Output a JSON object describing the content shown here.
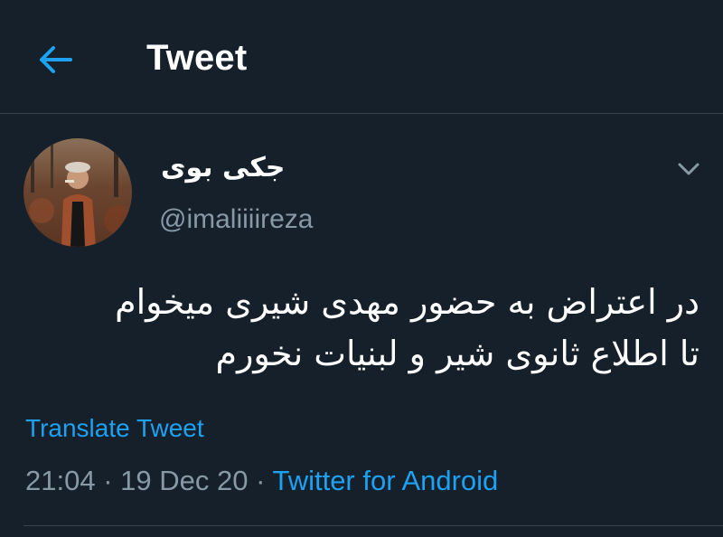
{
  "header": {
    "back_icon": "arrow-left-icon",
    "title": "Tweet"
  },
  "author": {
    "display_name": "جکی بوی",
    "handle": "@imaliiiireza",
    "avatar_icon": "avatar-photo",
    "more_icon": "chevron-down-icon"
  },
  "tweet": {
    "lines": [
      "در اعتراض به حضور مهدی شیری میخوام",
      "تا اطلاع ثانوی شیر و لبنیات نخورم"
    ],
    "translate_label": "Translate Tweet"
  },
  "meta": {
    "time": "21:04",
    "separator": " · ",
    "date": "19 Dec 20",
    "source": "Twitter for Android"
  },
  "colors": {
    "background": "#15202b",
    "accent": "#1da1f2",
    "secondary_text": "#8899a6",
    "divider": "#38444d"
  }
}
